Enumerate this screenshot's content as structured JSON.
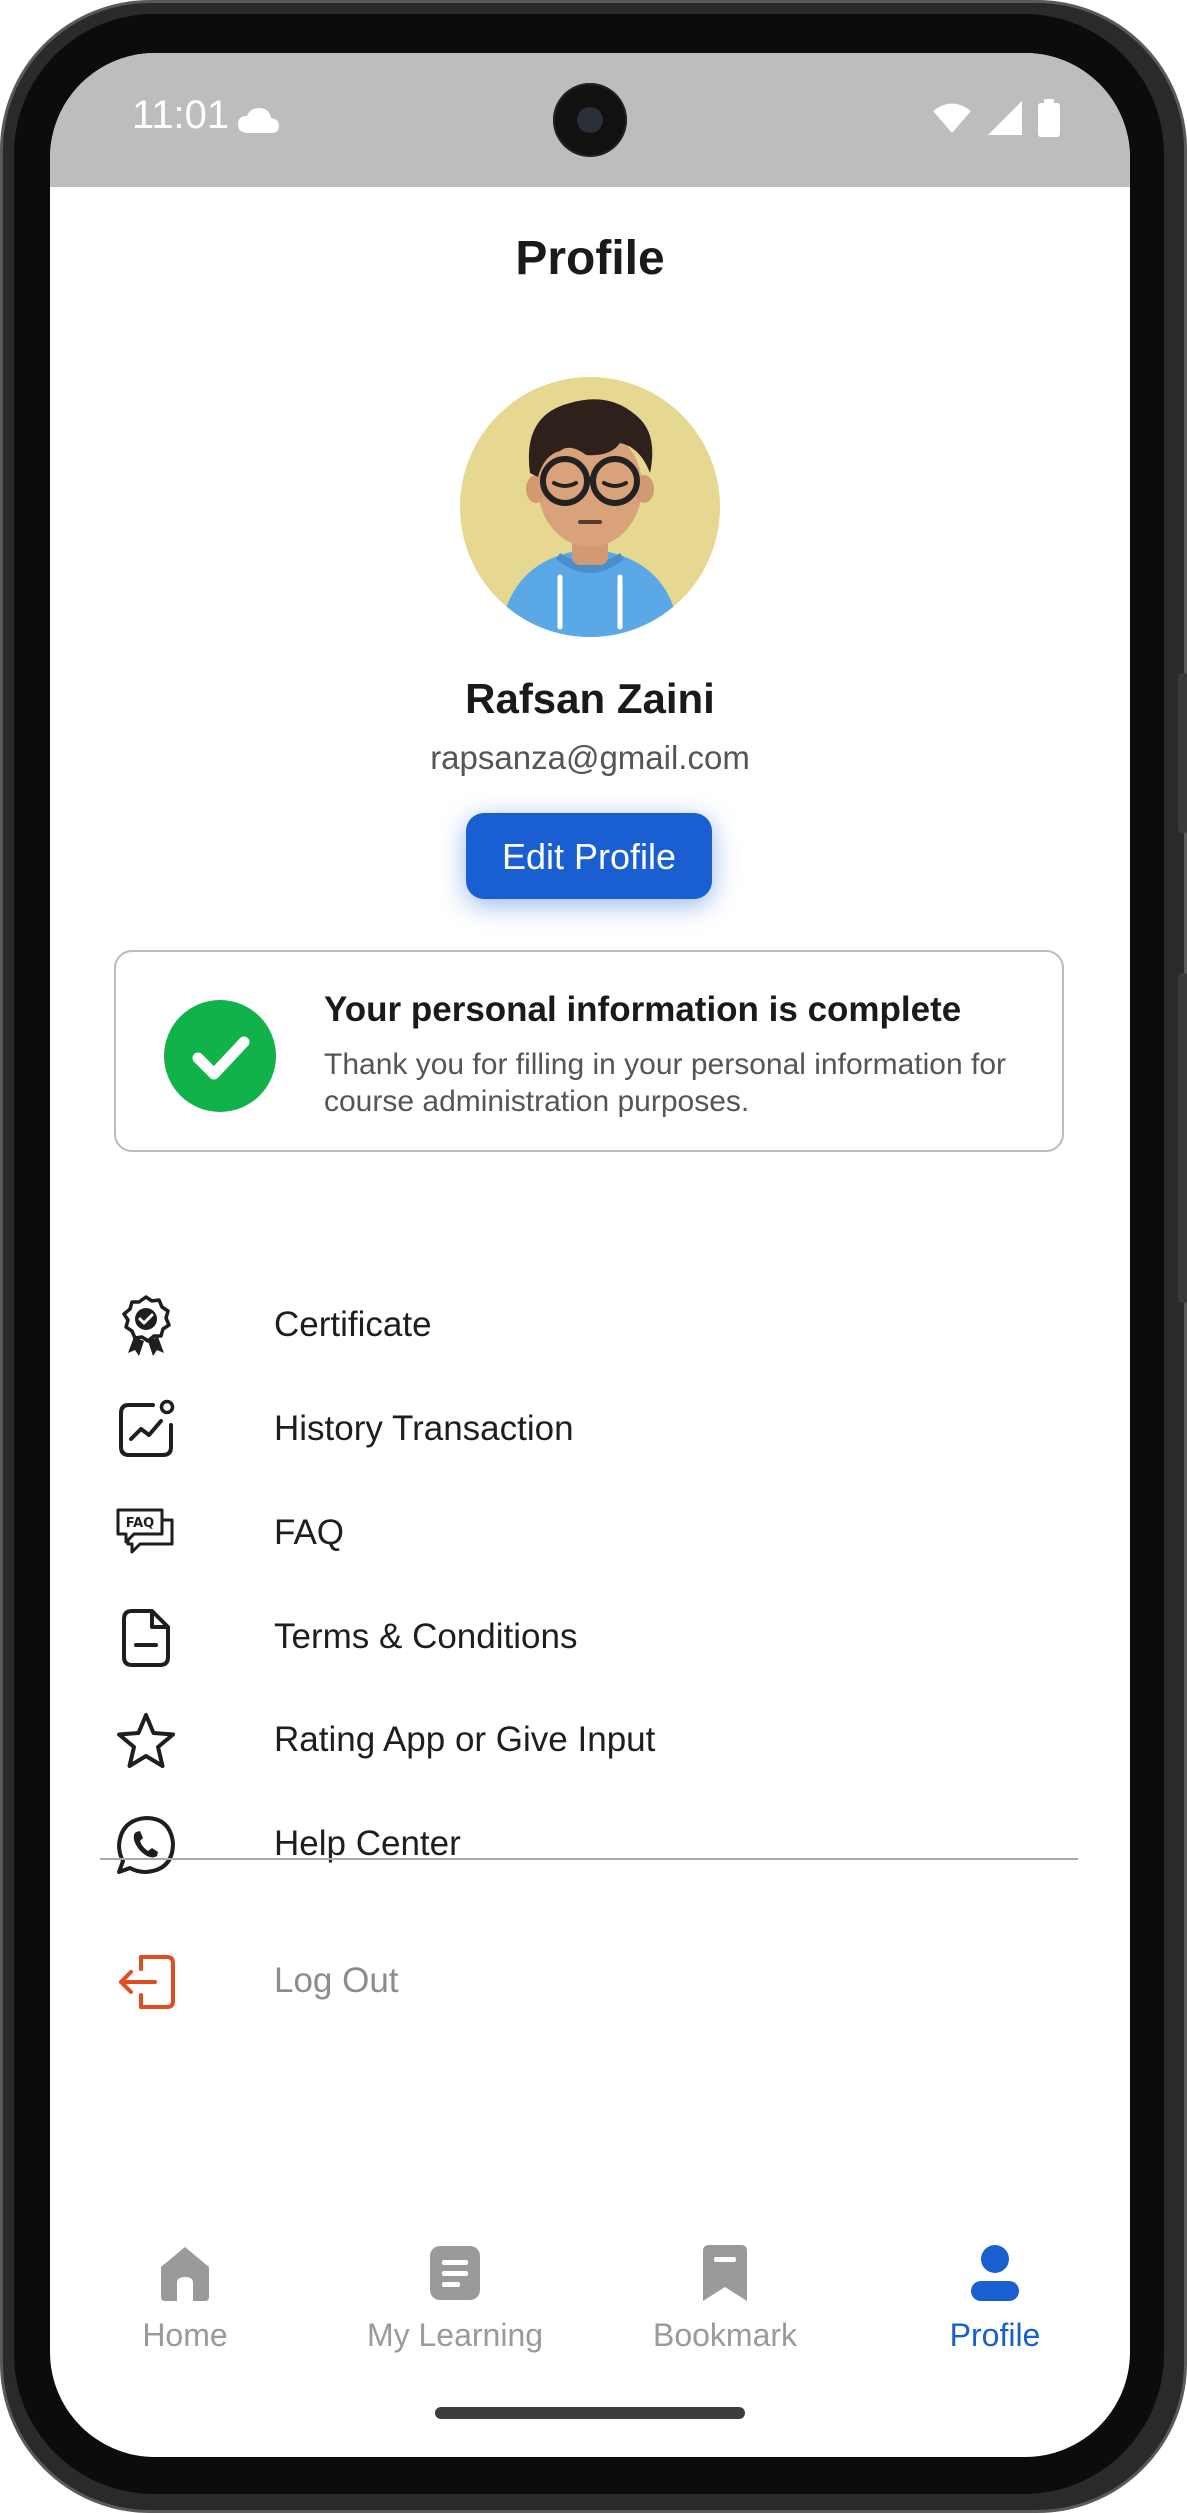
{
  "status_bar": {
    "time": "11:01"
  },
  "header": {
    "title": "Profile"
  },
  "profile": {
    "name": "Rafsan Zaini",
    "email": "rapsanza@gmail.com",
    "edit_label": "Edit Profile"
  },
  "info_card": {
    "title": "Your personal information is complete",
    "description": "Thank you for filling in your personal information for course administration purposes."
  },
  "menu": {
    "items": [
      {
        "label": "Certificate",
        "icon": "certificate-icon"
      },
      {
        "label": "History Transaction",
        "icon": "chart-icon"
      },
      {
        "label": "FAQ",
        "icon": "faq-icon"
      },
      {
        "label": "Terms & Conditions",
        "icon": "document-icon"
      },
      {
        "label": "Rating App or Give Input",
        "icon": "star-icon"
      },
      {
        "label": "Help Center",
        "icon": "whatsapp-icon"
      }
    ],
    "logout": {
      "label": "Log Out",
      "icon": "logout-icon"
    }
  },
  "bottom_nav": {
    "items": [
      {
        "label": "Home",
        "icon": "home-icon",
        "active": false
      },
      {
        "label": "My Learning",
        "icon": "learning-icon",
        "active": false
      },
      {
        "label": "Bookmark",
        "icon": "bookmark-icon",
        "active": false
      },
      {
        "label": "Profile",
        "icon": "person-icon",
        "active": true
      }
    ]
  },
  "colors": {
    "accent": "#1a5fd1",
    "success": "#12b24a",
    "logout": "#e04e1f",
    "status_bar": "#bdbdbd"
  }
}
